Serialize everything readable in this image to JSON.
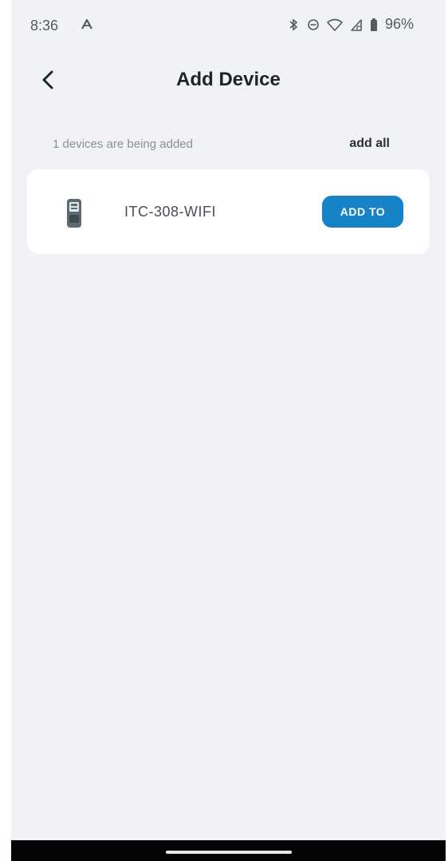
{
  "status_bar": {
    "time": "8:36",
    "left_icon": "notification-a-icon",
    "right_icons": [
      "bluetooth-icon",
      "do-not-disturb-icon",
      "wifi-icon",
      "signal-icon",
      "battery-icon"
    ],
    "battery_percent": "96%"
  },
  "header": {
    "title": "Add Device",
    "back_icon": "chevron-left-icon"
  },
  "info": {
    "count_text": "1 devices are being added",
    "add_all_label": "add all"
  },
  "devices": [
    {
      "name": "ITC-308-WIFI",
      "icon": "thermostat-controller-icon",
      "button_label": "ADD TO"
    }
  ],
  "colors": {
    "background": "#f1f2f6",
    "card": "#ffffff",
    "accent": "#1683c6",
    "title_text": "#1f2329",
    "secondary_text": "#8b9097"
  }
}
